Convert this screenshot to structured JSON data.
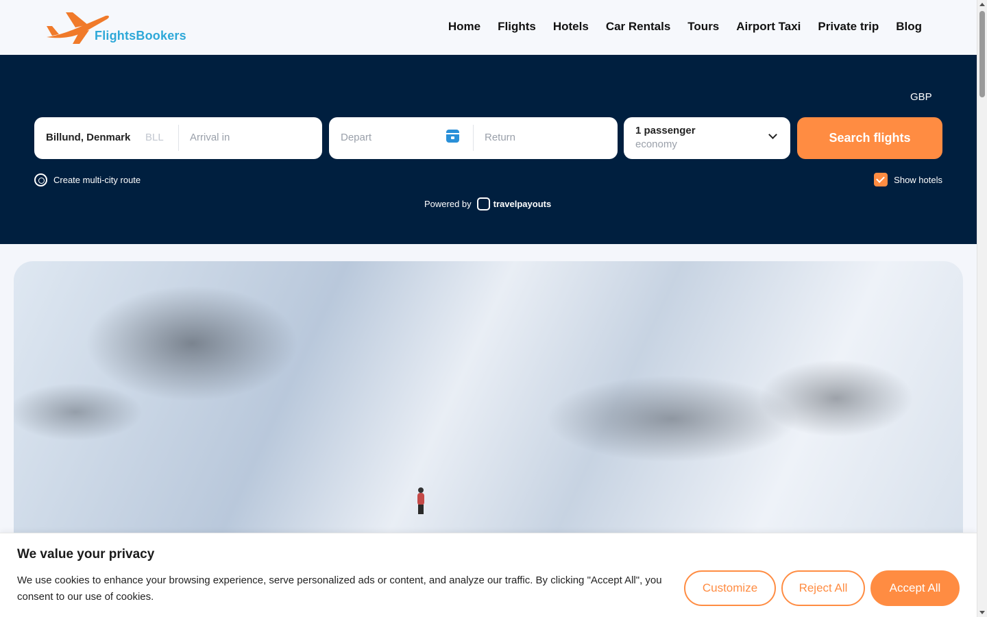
{
  "brand": {
    "name": "FlightsBookers",
    "plane_color": "#f07a2a",
    "text_color": "#2ea8d8"
  },
  "nav": {
    "items": [
      "Home",
      "Flights",
      "Hotels",
      "Car Rentals",
      "Tours",
      "Airport Taxi",
      "Private trip",
      "Blog"
    ]
  },
  "search": {
    "currency": "GBP",
    "origin_city": "Billund, Denmark",
    "origin_code": "BLL",
    "destination_placeholder": "Arrival in",
    "depart_placeholder": "Depart",
    "return_placeholder": "Return",
    "passengers": "1 passenger",
    "cabin_class": "economy",
    "submit_label": "Search flights",
    "multi_city_label": "Create multi-city route",
    "show_hotels_label": "Show hotels",
    "show_hotels_checked": true,
    "powered_by_label": "Powered by",
    "powered_by_brand": "travelpayouts"
  },
  "cookie_banner": {
    "title": "We value your privacy",
    "text": "We use cookies to enhance your browsing experience, serve personalized ads or content, and analyze our traffic. By clicking \"Accept All\", you consent to our use of cookies.",
    "customize_label": "Customize",
    "reject_label": "Reject All",
    "accept_label": "Accept All"
  },
  "colors": {
    "accent": "#ff8c42",
    "panel_bg": "#001f3f",
    "calendar_icon": "#2a90d8"
  }
}
